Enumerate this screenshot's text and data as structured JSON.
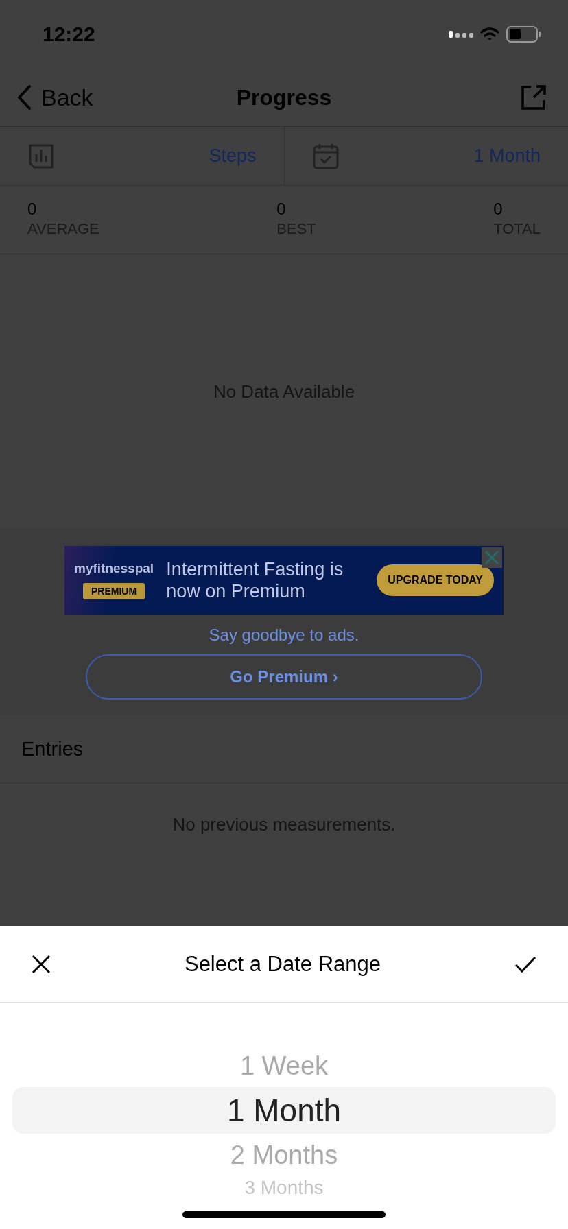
{
  "status_bar": {
    "time": "12:22"
  },
  "nav": {
    "back": "Back",
    "title": "Progress"
  },
  "filters": [
    {
      "kind": "chart",
      "label": "Steps"
    },
    {
      "kind": "calendar",
      "label": "1 Month"
    }
  ],
  "stats": [
    {
      "value": "0",
      "label": "AVERAGE"
    },
    {
      "value": "0",
      "label": "BEST"
    },
    {
      "value": "0",
      "label": "TOTAL"
    }
  ],
  "chart": {
    "empty_text": "No Data Available"
  },
  "ad": {
    "brand": "myfitnesspal",
    "badge": "PREMIUM",
    "headline": "Intermittent Fasting is now on Premium",
    "cta": "UPGRADE TODAY"
  },
  "premium": {
    "text": "Say goodbye to ads.",
    "button": "Go Premium ›"
  },
  "entries": {
    "title": "Entries",
    "empty_text": "No previous measurements."
  },
  "sheet": {
    "title": "Select a Date Range",
    "options": [
      {
        "label": "1 Week",
        "selected": false
      },
      {
        "label": "1 Month",
        "selected": true
      },
      {
        "label": "2 Months",
        "selected": false
      },
      {
        "label": "3 Months",
        "selected": false
      }
    ]
  }
}
